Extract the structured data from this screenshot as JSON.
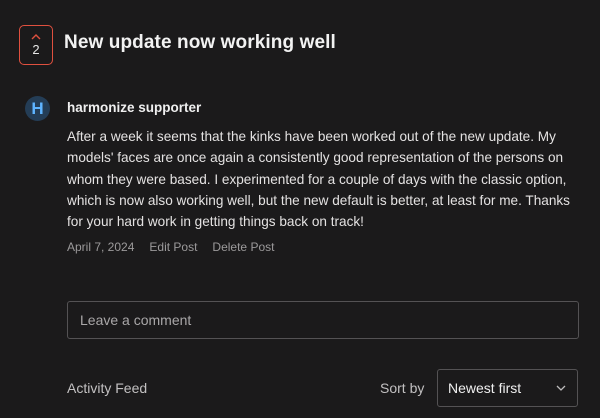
{
  "post": {
    "vote_count": "2",
    "title": "New update now working well",
    "author_initial": "H",
    "author": "harmonize supporter",
    "body": "After a week it seems that the kinks have been worked out of the new update. My models' faces are once again a consistently good representation of the persons on whom they were based.  I experimented for a couple of days with the classic option, which is now also working well, but the new default is better, at least for me. Thanks for your hard work in getting things back on track!",
    "date": "April 7, 2024",
    "edit_label": "Edit Post",
    "delete_label": "Delete Post"
  },
  "comment": {
    "placeholder": "Leave a comment"
  },
  "feed": {
    "label": "Activity Feed",
    "sort_label": "Sort by",
    "sort_value": "Newest first"
  },
  "colors": {
    "background": "#1b1a1b",
    "vote_accent": "#e0503f",
    "avatar_bg": "#243d56",
    "avatar_fg": "#5fb4ff"
  }
}
